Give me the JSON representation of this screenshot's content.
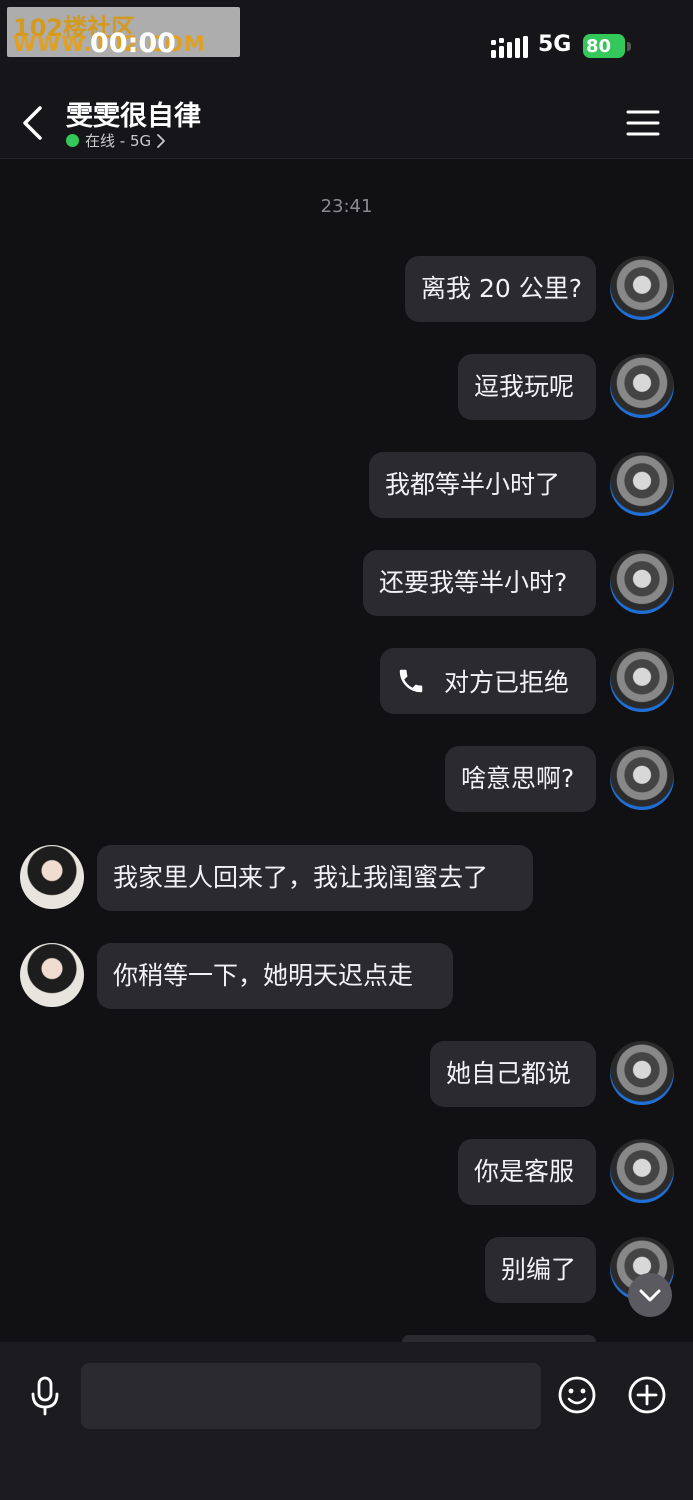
{
  "status_bar": {
    "time": "00:00",
    "network": "5G",
    "battery": "80",
    "watermark_line1": "102楼社区",
    "watermark_line2": "WWW.102.COM"
  },
  "header": {
    "contact_name": "雯雯很自律",
    "status_text": "在线 - 5G",
    "online_color": "#34c759"
  },
  "chat": {
    "timestamp": "23:41",
    "messages": [
      {
        "side": "right",
        "text": "离我 20 公里?"
      },
      {
        "side": "right",
        "text": "逗我玩呢"
      },
      {
        "side": "right",
        "text": "我都等半小时了"
      },
      {
        "side": "right",
        "text": "还要我等半小时?"
      },
      {
        "side": "right",
        "type": "call",
        "text": "对方已拒绝"
      },
      {
        "side": "right",
        "text": "啥意思啊?"
      },
      {
        "side": "left",
        "text": "我家里人回来了，我让我闺蜜去了"
      },
      {
        "side": "left",
        "text": "你稍等一下，她明天迟点走"
      },
      {
        "side": "right",
        "text": "她自己都说"
      },
      {
        "side": "right",
        "text": "你是客服"
      },
      {
        "side": "right",
        "text": "别编了"
      }
    ]
  },
  "input_bar": {
    "placeholder": ""
  },
  "icons": [
    "back-arrow-icon",
    "menu-icon",
    "phone-icon",
    "chevron-down-icon",
    "microphone-icon",
    "emoji-icon",
    "plus-circle-icon",
    "signal-icon"
  ]
}
